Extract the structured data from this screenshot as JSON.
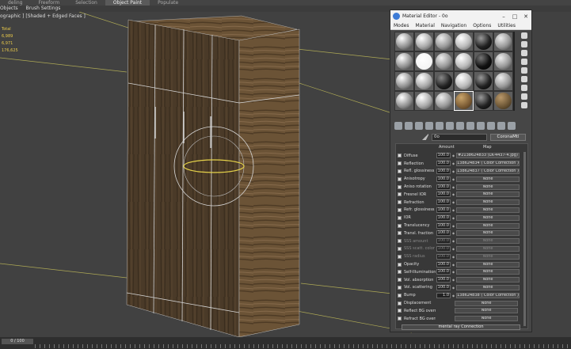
{
  "ribbon": {
    "tabs": [
      "deling",
      "Freeform",
      "Selection",
      "Object Paint",
      "Populate"
    ],
    "active_tab": "Object Paint",
    "subbar": [
      "Objects",
      "Brush Settings"
    ]
  },
  "viewport": {
    "label": "ographic ] [Shaded + Edged Faces ]",
    "stats": [
      "Total",
      "6,989",
      "6,971",
      "176,625"
    ]
  },
  "material_editor": {
    "title": "Material Editor - 0o",
    "menu": [
      "Modes",
      "Material",
      "Navigation",
      "Options",
      "Utilities"
    ],
    "material_name": "0o",
    "material_type": "CoronaMtl",
    "column_headers": {
      "amount": "Amount",
      "map": "Map"
    },
    "params": [
      {
        "label": "Diffuse",
        "amount": "100.0",
        "map": "#2138624833 (LK-4437-4.jpg)",
        "enabled": true
      },
      {
        "label": "Reflection",
        "amount": "100.0",
        "map": "138624834 ( Color Correction )",
        "enabled": true
      },
      {
        "label": "Refl. glossiness",
        "amount": "100.0",
        "map": "138624837 ( Color Correction )",
        "enabled": true
      },
      {
        "label": "Anisotropy",
        "amount": "100.0",
        "map": "None",
        "enabled": true
      },
      {
        "label": "Aniso rotation",
        "amount": "100.0",
        "map": "None",
        "enabled": true
      },
      {
        "label": "Fresnel IOR",
        "amount": "100.0",
        "map": "None",
        "enabled": true
      },
      {
        "label": "Refraction",
        "amount": "100.0",
        "map": "None",
        "enabled": true
      },
      {
        "label": "Refr. glossiness",
        "amount": "100.0",
        "map": "None",
        "enabled": true
      },
      {
        "label": "IOR",
        "amount": "100.0",
        "map": "None",
        "enabled": true
      },
      {
        "label": "Translucency",
        "amount": "100.0",
        "map": "None",
        "enabled": true
      },
      {
        "label": "Transl. fraction",
        "amount": "100.0",
        "map": "None",
        "enabled": true
      },
      {
        "label": "SSS amount",
        "amount": "100.0",
        "map": "None",
        "enabled": false
      },
      {
        "label": "SSS scatt. color",
        "amount": "100.0",
        "map": "None",
        "enabled": false
      },
      {
        "label": "SSS radius",
        "amount": "100.0",
        "map": "None",
        "enabled": false
      },
      {
        "label": "Opacity",
        "amount": "100.0",
        "map": "None",
        "enabled": true
      },
      {
        "label": "Self-Illumination",
        "amount": "100.0",
        "map": "None",
        "enabled": true
      },
      {
        "label": "Vol. absorption",
        "amount": "100.0",
        "map": "None",
        "enabled": true
      },
      {
        "label": "Vol. scattering",
        "amount": "100.0",
        "map": "None",
        "enabled": true
      },
      {
        "label": "Bump",
        "amount": "1.0",
        "map": "138624838 ( Color Correction )",
        "enabled": true
      },
      {
        "label": "Displacement",
        "amount": "",
        "map": "None",
        "enabled": true
      },
      {
        "label": "Reflect BG override",
        "amount": "",
        "map": "None",
        "enabled": true
      },
      {
        "label": "Refract BG override",
        "amount": "",
        "map": "None",
        "enabled": true
      }
    ],
    "footer": "mental ray Connection"
  },
  "timeline": {
    "frame": "0 / 100"
  }
}
